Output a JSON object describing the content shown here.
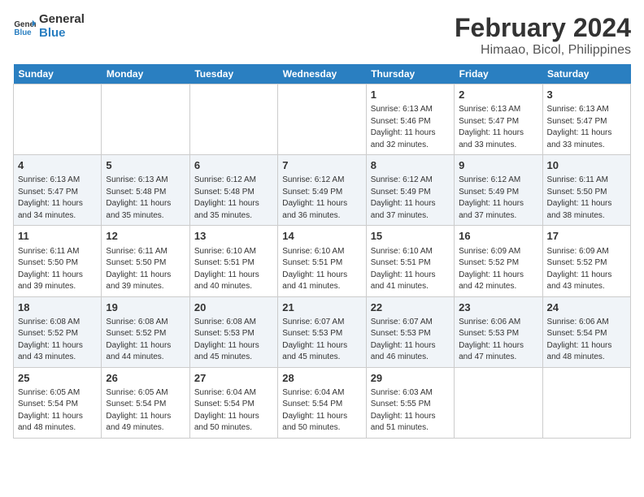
{
  "logo": {
    "name": "General",
    "name2": "Blue"
  },
  "title": "February 2024",
  "subtitle": "Himaao, Bicol, Philippines",
  "headers": [
    "Sunday",
    "Monday",
    "Tuesday",
    "Wednesday",
    "Thursday",
    "Friday",
    "Saturday"
  ],
  "weeks": [
    [
      {
        "num": "",
        "info": ""
      },
      {
        "num": "",
        "info": ""
      },
      {
        "num": "",
        "info": ""
      },
      {
        "num": "",
        "info": ""
      },
      {
        "num": "1",
        "info": "Sunrise: 6:13 AM\nSunset: 5:46 PM\nDaylight: 11 hours and 32 minutes."
      },
      {
        "num": "2",
        "info": "Sunrise: 6:13 AM\nSunset: 5:47 PM\nDaylight: 11 hours and 33 minutes."
      },
      {
        "num": "3",
        "info": "Sunrise: 6:13 AM\nSunset: 5:47 PM\nDaylight: 11 hours and 33 minutes."
      }
    ],
    [
      {
        "num": "4",
        "info": "Sunrise: 6:13 AM\nSunset: 5:47 PM\nDaylight: 11 hours and 34 minutes."
      },
      {
        "num": "5",
        "info": "Sunrise: 6:13 AM\nSunset: 5:48 PM\nDaylight: 11 hours and 35 minutes."
      },
      {
        "num": "6",
        "info": "Sunrise: 6:12 AM\nSunset: 5:48 PM\nDaylight: 11 hours and 35 minutes."
      },
      {
        "num": "7",
        "info": "Sunrise: 6:12 AM\nSunset: 5:49 PM\nDaylight: 11 hours and 36 minutes."
      },
      {
        "num": "8",
        "info": "Sunrise: 6:12 AM\nSunset: 5:49 PM\nDaylight: 11 hours and 37 minutes."
      },
      {
        "num": "9",
        "info": "Sunrise: 6:12 AM\nSunset: 5:49 PM\nDaylight: 11 hours and 37 minutes."
      },
      {
        "num": "10",
        "info": "Sunrise: 6:11 AM\nSunset: 5:50 PM\nDaylight: 11 hours and 38 minutes."
      }
    ],
    [
      {
        "num": "11",
        "info": "Sunrise: 6:11 AM\nSunset: 5:50 PM\nDaylight: 11 hours and 39 minutes."
      },
      {
        "num": "12",
        "info": "Sunrise: 6:11 AM\nSunset: 5:50 PM\nDaylight: 11 hours and 39 minutes."
      },
      {
        "num": "13",
        "info": "Sunrise: 6:10 AM\nSunset: 5:51 PM\nDaylight: 11 hours and 40 minutes."
      },
      {
        "num": "14",
        "info": "Sunrise: 6:10 AM\nSunset: 5:51 PM\nDaylight: 11 hours and 41 minutes."
      },
      {
        "num": "15",
        "info": "Sunrise: 6:10 AM\nSunset: 5:51 PM\nDaylight: 11 hours and 41 minutes."
      },
      {
        "num": "16",
        "info": "Sunrise: 6:09 AM\nSunset: 5:52 PM\nDaylight: 11 hours and 42 minutes."
      },
      {
        "num": "17",
        "info": "Sunrise: 6:09 AM\nSunset: 5:52 PM\nDaylight: 11 hours and 43 minutes."
      }
    ],
    [
      {
        "num": "18",
        "info": "Sunrise: 6:08 AM\nSunset: 5:52 PM\nDaylight: 11 hours and 43 minutes."
      },
      {
        "num": "19",
        "info": "Sunrise: 6:08 AM\nSunset: 5:52 PM\nDaylight: 11 hours and 44 minutes."
      },
      {
        "num": "20",
        "info": "Sunrise: 6:08 AM\nSunset: 5:53 PM\nDaylight: 11 hours and 45 minutes."
      },
      {
        "num": "21",
        "info": "Sunrise: 6:07 AM\nSunset: 5:53 PM\nDaylight: 11 hours and 45 minutes."
      },
      {
        "num": "22",
        "info": "Sunrise: 6:07 AM\nSunset: 5:53 PM\nDaylight: 11 hours and 46 minutes."
      },
      {
        "num": "23",
        "info": "Sunrise: 6:06 AM\nSunset: 5:53 PM\nDaylight: 11 hours and 47 minutes."
      },
      {
        "num": "24",
        "info": "Sunrise: 6:06 AM\nSunset: 5:54 PM\nDaylight: 11 hours and 48 minutes."
      }
    ],
    [
      {
        "num": "25",
        "info": "Sunrise: 6:05 AM\nSunset: 5:54 PM\nDaylight: 11 hours and 48 minutes."
      },
      {
        "num": "26",
        "info": "Sunrise: 6:05 AM\nSunset: 5:54 PM\nDaylight: 11 hours and 49 minutes."
      },
      {
        "num": "27",
        "info": "Sunrise: 6:04 AM\nSunset: 5:54 PM\nDaylight: 11 hours and 50 minutes."
      },
      {
        "num": "28",
        "info": "Sunrise: 6:04 AM\nSunset: 5:54 PM\nDaylight: 11 hours and 50 minutes."
      },
      {
        "num": "29",
        "info": "Sunrise: 6:03 AM\nSunset: 5:55 PM\nDaylight: 11 hours and 51 minutes."
      },
      {
        "num": "",
        "info": ""
      },
      {
        "num": "",
        "info": ""
      }
    ]
  ]
}
